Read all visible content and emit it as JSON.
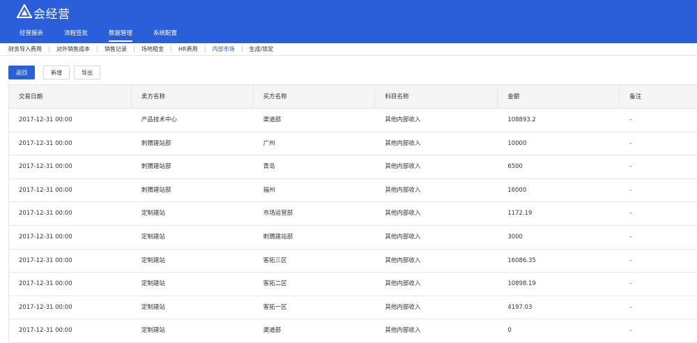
{
  "app": {
    "name": "会经营"
  },
  "main_nav": [
    {
      "label": "经营报表",
      "active": false
    },
    {
      "label": "流程签批",
      "active": false
    },
    {
      "label": "数据管理",
      "active": true
    },
    {
      "label": "系统配置",
      "active": false
    }
  ],
  "sub_nav": [
    {
      "label": "财务导入费用",
      "active": false
    },
    {
      "label": "对外销售成本",
      "active": false
    },
    {
      "label": "销售记录",
      "active": false
    },
    {
      "label": "场地租金",
      "active": false
    },
    {
      "label": "HR费用",
      "active": false
    },
    {
      "label": "内部市场",
      "active": true
    },
    {
      "label": "生成/锁定",
      "active": false
    }
  ],
  "toolbar": {
    "back_label": "返回",
    "add_label": "新增",
    "export_label": "导出"
  },
  "table": {
    "columns": [
      "交易日期",
      "卖方名称",
      "买方名称",
      "科目名称",
      "金额",
      "备注"
    ],
    "rows": [
      [
        "2017-12-31 00:00",
        "产品技术中心",
        "渠道部",
        "其他内部收入",
        "108893.2",
        "-"
      ],
      [
        "2017-12-31 00:00",
        "刺猬建站部",
        "广州",
        "其他内部收入",
        "10000",
        "-"
      ],
      [
        "2017-12-31 00:00",
        "刺猬建站部",
        "青岛",
        "其他内部收入",
        "6500",
        "-"
      ],
      [
        "2017-12-31 00:00",
        "刺猬建站部",
        "福州",
        "其他内部收入",
        "16000",
        "-"
      ],
      [
        "2017-12-31 00:00",
        "定制建站",
        "市场运营部",
        "其他内部收入",
        "1172.19",
        "-"
      ],
      [
        "2017-12-31 00:00",
        "定制建站",
        "刺猬建站部",
        "其他内部收入",
        "3000",
        "-"
      ],
      [
        "2017-12-31 00:00",
        "定制建站",
        "客拓三区",
        "其他内部收入",
        "16086.35",
        "-"
      ],
      [
        "2017-12-31 00:00",
        "定制建站",
        "客拓二区",
        "其他内部收入",
        "10898.19",
        "-"
      ],
      [
        "2017-12-31 00:00",
        "定制建站",
        "客拓一区",
        "其他内部收入",
        "4197.03",
        "-"
      ],
      [
        "2017-12-31 00:00",
        "定制建站",
        "渠道部",
        "其他内部收入",
        "0",
        "-"
      ]
    ]
  },
  "colors": {
    "brand": "#2b5fd9",
    "header_bg": "#f5f5f5"
  }
}
